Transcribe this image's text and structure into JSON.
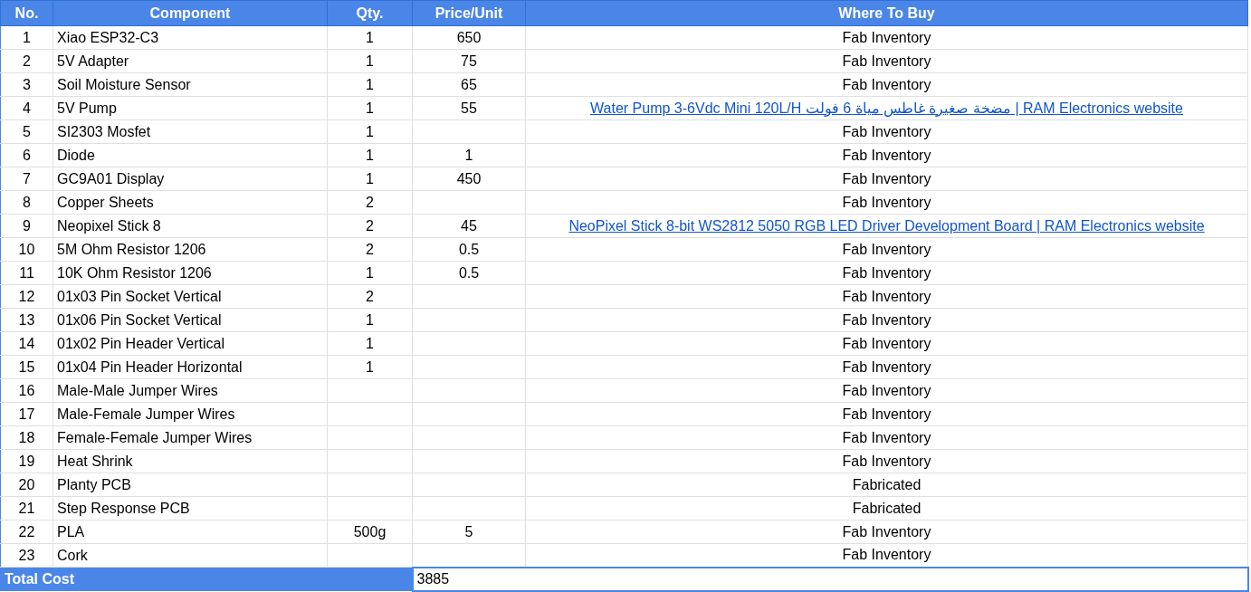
{
  "columns": [
    "No.",
    "Component",
    "Qty.",
    "Price/Unit",
    "Where To Buy"
  ],
  "rows": [
    {
      "no": "1",
      "component": "Xiao ESP32-C3",
      "qty": "1",
      "price": "650",
      "where": {
        "kind": "text",
        "text": "Fab Inventory"
      }
    },
    {
      "no": "2",
      "component": "5V Adapter",
      "qty": "1",
      "price": "75",
      "where": {
        "kind": "text",
        "text": "Fab Inventory"
      }
    },
    {
      "no": "3",
      "component": "Soil Moisture Sensor",
      "qty": "1",
      "price": "65",
      "where": {
        "kind": "text",
        "text": "Fab Inventory"
      }
    },
    {
      "no": "4",
      "component": "5V Pump",
      "qty": "1",
      "price": "55",
      "where": {
        "kind": "link",
        "text": "Water Pump 3-6Vdc Mini 120L/H مضخة صغيرة غاطس مياة 6 فولت | RAM Electronics website"
      }
    },
    {
      "no": "5",
      "component": "SI2303 Mosfet",
      "qty": "1",
      "price": "",
      "where": {
        "kind": "text",
        "text": "Fab Inventory"
      }
    },
    {
      "no": "6",
      "component": "Diode",
      "qty": "1",
      "price": "1",
      "where": {
        "kind": "text",
        "text": "Fab Inventory"
      }
    },
    {
      "no": "7",
      "component": "GC9A01 Display",
      "qty": "1",
      "price": "450",
      "where": {
        "kind": "text",
        "text": "Fab Inventory"
      }
    },
    {
      "no": "8",
      "component": "Copper Sheets",
      "qty": "2",
      "price": "",
      "where": {
        "kind": "text",
        "text": "Fab Inventory"
      }
    },
    {
      "no": "9",
      "component": "Neopixel Stick 8",
      "qty": "2",
      "price": "45",
      "where": {
        "kind": "link",
        "text": "NeoPixel Stick 8-bit WS2812 5050 RGB LED Driver Development Board | RAM Electronics website"
      }
    },
    {
      "no": "10",
      "component": "5M Ohm Resistor 1206",
      "qty": "2",
      "price": "0.5",
      "where": {
        "kind": "text",
        "text": "Fab Inventory"
      }
    },
    {
      "no": "11",
      "component": "10K Ohm Resistor 1206",
      "qty": "1",
      "price": "0.5",
      "where": {
        "kind": "text",
        "text": "Fab Inventory"
      }
    },
    {
      "no": "12",
      "component": "01x03 Pin Socket Vertical",
      "qty": "2",
      "price": "",
      "where": {
        "kind": "text",
        "text": "Fab Inventory"
      }
    },
    {
      "no": "13",
      "component": "01x06 Pin Socket Vertical",
      "qty": "1",
      "price": "",
      "where": {
        "kind": "text",
        "text": "Fab Inventory"
      }
    },
    {
      "no": "14",
      "component": "01x02 Pin Header Vertical",
      "qty": "1",
      "price": "",
      "where": {
        "kind": "text",
        "text": "Fab Inventory"
      }
    },
    {
      "no": "15",
      "component": "01x04 Pin Header Horizontal",
      "qty": "1",
      "price": "",
      "where": {
        "kind": "text",
        "text": "Fab Inventory"
      }
    },
    {
      "no": "16",
      "component": "Male-Male Jumper Wires",
      "qty": "",
      "price": "",
      "where": {
        "kind": "text",
        "text": "Fab Inventory"
      }
    },
    {
      "no": "17",
      "component": "Male-Female Jumper Wires",
      "qty": "",
      "price": "",
      "where": {
        "kind": "text",
        "text": "Fab Inventory"
      }
    },
    {
      "no": "18",
      "component": "Female-Female Jumper Wires",
      "qty": "",
      "price": "",
      "where": {
        "kind": "text",
        "text": "Fab Inventory"
      }
    },
    {
      "no": "19",
      "component": "Heat Shrink",
      "qty": "",
      "price": "",
      "where": {
        "kind": "text",
        "text": "Fab Inventory"
      }
    },
    {
      "no": "20",
      "component": "Planty PCB",
      "qty": "",
      "price": "",
      "where": {
        "kind": "text",
        "text": "Fabricated"
      }
    },
    {
      "no": "21",
      "component": "Step Response PCB",
      "qty": "",
      "price": "",
      "where": {
        "kind": "text",
        "text": "Fabricated"
      }
    },
    {
      "no": "22",
      "component": "PLA",
      "qty": "500g",
      "price": "5",
      "where": {
        "kind": "text",
        "text": "Fab Inventory"
      }
    },
    {
      "no": "23",
      "component": "Cork",
      "qty": "",
      "price": "",
      "where": {
        "kind": "text",
        "text": "Fab Inventory"
      }
    }
  ],
  "total": {
    "label": "Total Cost",
    "value": "3885"
  }
}
